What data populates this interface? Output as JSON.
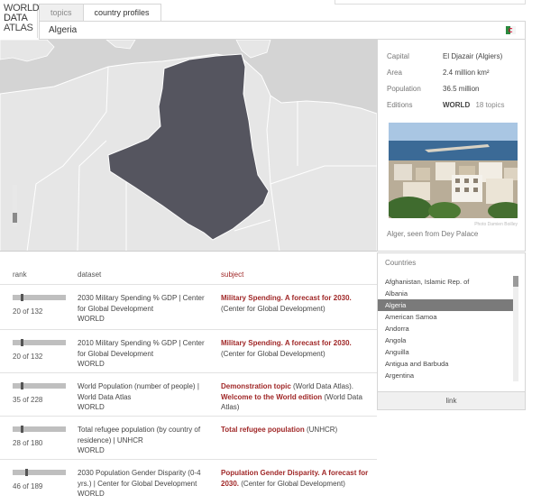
{
  "logo": {
    "line1": "WORLD",
    "line2": "DATA",
    "line3": "ATLAS"
  },
  "tabs": [
    {
      "label": "topics",
      "active": false
    },
    {
      "label": "country profiles",
      "active": true
    }
  ],
  "country": {
    "name": "Algeria"
  },
  "info": {
    "capital_label": "Capital",
    "capital_value": "El Djazair (Algiers)",
    "area_label": "Area",
    "area_value": "2.4 million km²",
    "population_label": "Population",
    "population_value": "36.5 million",
    "editions_label": "Editions",
    "editions_value": "WORLD",
    "editions_topics": "18 topics",
    "photo_credit": "Photo Damien Boilley",
    "photo_caption": "Alger, seen from Dey Palace"
  },
  "countries": {
    "header": "Countries",
    "items": [
      {
        "label": "Afghanistan, Islamic Rep. of",
        "selected": false
      },
      {
        "label": "Albania",
        "selected": false
      },
      {
        "label": "Algeria",
        "selected": true
      },
      {
        "label": "American Samoa",
        "selected": false
      },
      {
        "label": "Andorra",
        "selected": false
      },
      {
        "label": "Angola",
        "selected": false
      },
      {
        "label": "Anguilla",
        "selected": false
      },
      {
        "label": "Antigua and Barbuda",
        "selected": false
      },
      {
        "label": "Argentina",
        "selected": false
      }
    ],
    "link_label": "link"
  },
  "table": {
    "headers": {
      "rank": "rank",
      "dataset": "dataset",
      "subject": "subject"
    },
    "rows": [
      {
        "rank": "20 of 132",
        "rank_fraction": 0.15,
        "dataset": "2030 Military Spending % GDP | Center for Global Development",
        "edition": "WORLD",
        "subject_bold": "Military Spending. A forecast for 2030.",
        "subject_rest": " (Center for Global Development)"
      },
      {
        "rank": "20 of 132",
        "rank_fraction": 0.15,
        "dataset": "2010 Military Spending % GDP | Center for Global Development",
        "edition": "WORLD",
        "subject_bold": "Military Spending. A forecast for 2030.",
        "subject_rest": " (Center for Global Development)"
      },
      {
        "rank": "35 of 228",
        "rank_fraction": 0.15,
        "dataset": "World Population (number of people) | World Data Atlas",
        "edition": "WORLD",
        "subject_bold": "Demonstration topic",
        "subject_rest": " (World Data Atlas).",
        "subject_bold2": "Welcome to the World edition",
        "subject_rest2": " (World Data Atlas)"
      },
      {
        "rank": "28 of 180",
        "rank_fraction": 0.16,
        "dataset": "Total refugee population (by country of residence) | UNHCR",
        "edition": "WORLD",
        "subject_bold": "Total refugee population",
        "subject_rest": " (UNHCR)"
      },
      {
        "rank": "46 of 189",
        "rank_fraction": 0.24,
        "dataset": "2030 Population Gender Disparity (0-4 yrs.) | Center for Global Development",
        "edition": "WORLD",
        "subject_bold": "Population Gender Disparity. A forecast for 2030.",
        "subject_rest": " (Center for Global Development)"
      }
    ]
  },
  "colors": {
    "accent": "#a02828",
    "country_fill": "#55555f",
    "map_land": "#e6e6e6",
    "map_sea": "#d4d4d4"
  }
}
